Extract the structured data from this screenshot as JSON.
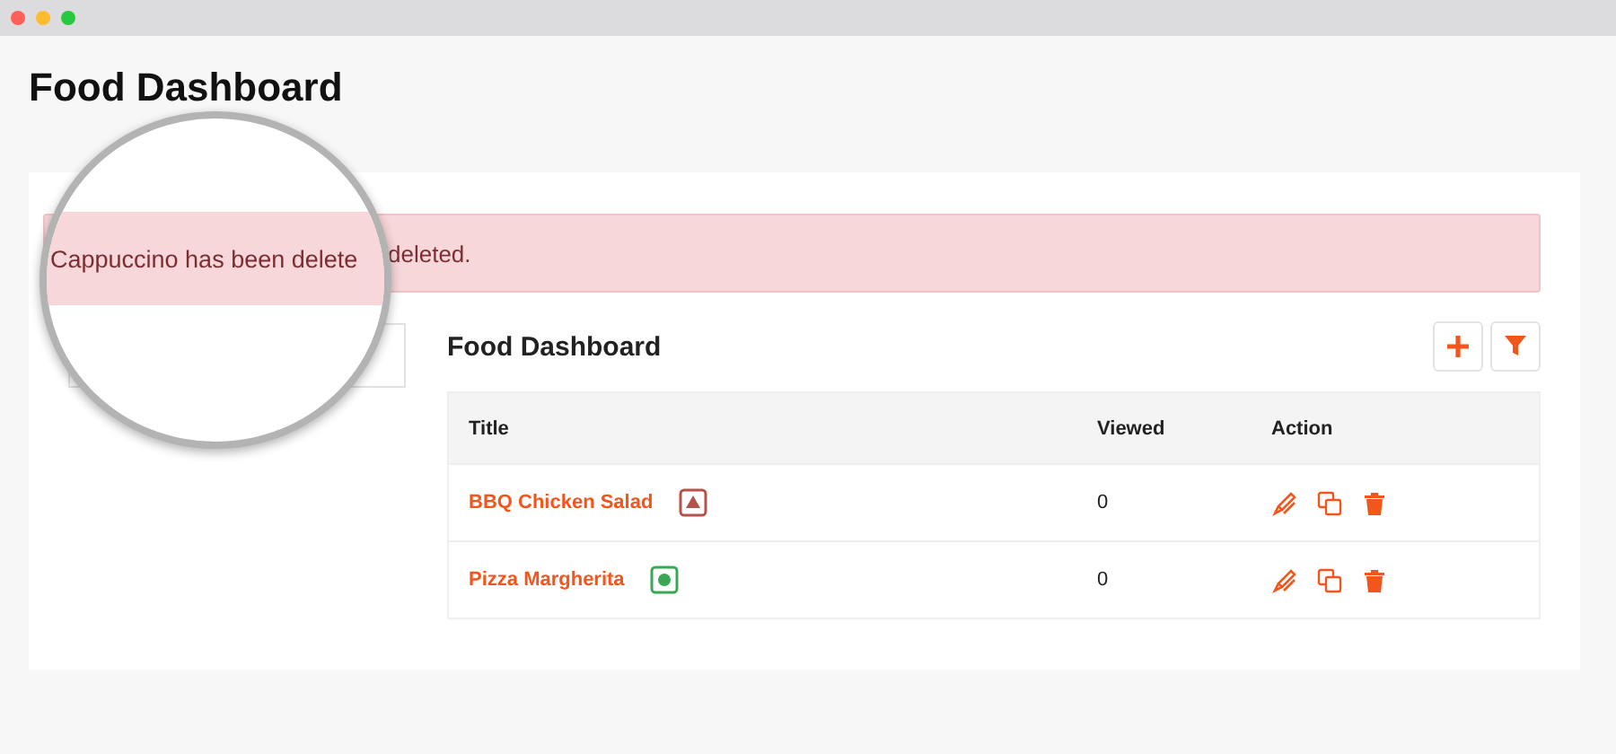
{
  "page_title": "Food Dashboard",
  "alert": {
    "message": "deleted."
  },
  "magnifier": {
    "text": "Cappuccino has been delete"
  },
  "panel": {
    "title": "Food Dashboard"
  },
  "table": {
    "columns": [
      "Title",
      "Viewed",
      "Action"
    ],
    "rows": [
      {
        "title": "BBQ Chicken Salad",
        "kind": "triangle",
        "color": "#b5524a",
        "viewed": "0"
      },
      {
        "title": "Pizza Margherita",
        "kind": "dot",
        "color": "#3aa757",
        "viewed": "0"
      }
    ]
  }
}
